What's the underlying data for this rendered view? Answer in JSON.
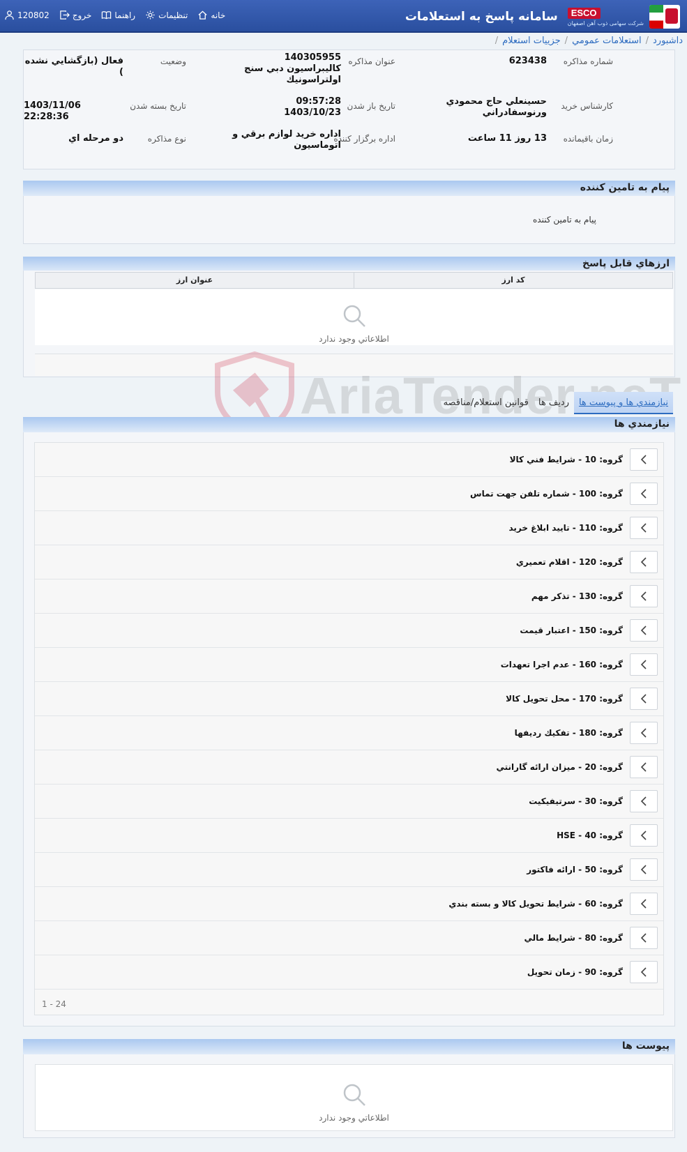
{
  "header": {
    "app_title": "سامانه پاسخ به استعلامات",
    "brand": "ESCO",
    "brand_sub": "شرکت سهامی ذوب آهن اصفهان",
    "nav": {
      "home": "خانه",
      "settings": "تنظیمات",
      "guide": "راهنما",
      "logout": "خروج",
      "user_id": "120802"
    }
  },
  "breadcrumb": {
    "items": [
      "داشبورد",
      "استعلامات عمومي",
      "جزييات استعلام"
    ]
  },
  "info": {
    "negotiation_number_label": "شماره مذاكره",
    "negotiation_number": "623438",
    "negotiation_title_label": "عنوان مذاكره",
    "negotiation_title_line1": "140305955",
    "negotiation_title_line2": "كاليبراسيون دبي سنج",
    "negotiation_title_line3": "اولتراسونيك",
    "status_label": "وضعيت",
    "status": "فعال (بازگشايي نشده )",
    "buyer_expert_label": "كارشناس خريد",
    "buyer_expert_line1": "حسينعلي حاج محمودي",
    "buyer_expert_line2": "ورنوسفادراني",
    "open_date_label": "تاريخ باز شدن",
    "open_time": "09:57:28",
    "open_date": "1403/10/23",
    "close_date_label": "تاريخ بسته شدن",
    "close_date": "1403/11/06 22:28:36",
    "remaining_label": "زمان باقيمانده",
    "remaining": "13 روز 11 ساعت",
    "organizer_label": "اداره برگزار كننده",
    "organizer_line1": "اداره خريد لوازم برقي و",
    "organizer_line2": "اتوماسيون",
    "negotiation_type_label": "نوع مذاكره",
    "negotiation_type": "دو مرحله اي"
  },
  "supplier_message": {
    "title": "پيام به تامين كننده",
    "text": "پيام به تامين كننده"
  },
  "currencies": {
    "title": "ارزهاي قابل پاسخ",
    "col_code": "كد ارز",
    "col_title": "عنوان ارز",
    "empty": "اطلاعاتي وجود ندارد"
  },
  "tabs": [
    "نيازمندي ها و پيوست ها",
    "رديف ها",
    "قوانين استعلام/مناقصه"
  ],
  "requirements": {
    "title": "نيازمندي ها",
    "items": [
      "گروه: 10 - شرايط فني كالا",
      "گروه: 100 - شماره تلفن جهت تماس",
      "گروه: 110 - تاييد ابلاغ خريد",
      "گروه: 120 - اقلام تعميري",
      "گروه: 130 - تذكر مهم",
      "گروه: 150 - اعتبار قيمت",
      "گروه: 160 - عدم اجرا تعهدات",
      "گروه: 170 - محل تحويل كالا",
      "گروه: 180 - تفكيك رديفها",
      "گروه: 20 - ميزان ارائه گارانتي",
      "گروه: 30 - سرتيفيكيت",
      "گروه: 40 - HSE",
      "گروه: 50 - ارائه فاكتور",
      "گروه: 60 - شرايط تحويل كالا و بسته بندي",
      "گروه: 80 - شرايط مالي",
      "گروه: 90 - زمان تحويل"
    ],
    "pager": "1 - 24"
  },
  "attachments": {
    "title": "پيوست ها",
    "empty": "اطلاعاتي وجود ندارد"
  },
  "watermark": "AriaTender.neT"
}
